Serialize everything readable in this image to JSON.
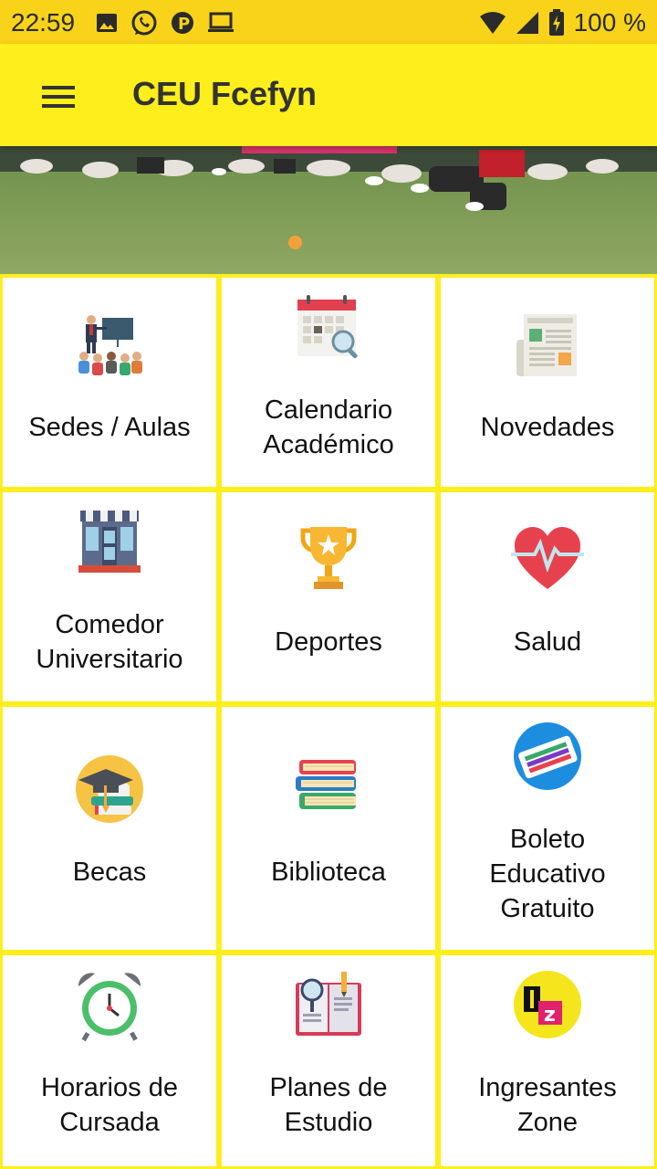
{
  "status_bar": {
    "time": "22:59",
    "battery": "100 %"
  },
  "app_bar": {
    "title": "CEU Fcefyn"
  },
  "carousel": {
    "pages": 1,
    "active": 0
  },
  "tiles": [
    {
      "label": "Sedes / Aulas",
      "icon": "classroom-icon"
    },
    {
      "label": "Calendario Académico",
      "icon": "calendar-icon"
    },
    {
      "label": "Novedades",
      "icon": "newspaper-icon"
    },
    {
      "label": "Comedor Universitario",
      "icon": "storefront-icon"
    },
    {
      "label": "Deportes",
      "icon": "trophy-icon"
    },
    {
      "label": "Salud",
      "icon": "heart-icon"
    },
    {
      "label": "Becas",
      "icon": "graduation-cap-icon"
    },
    {
      "label": "Biblioteca",
      "icon": "books-icon"
    },
    {
      "label": "Boleto Educativo Gratuito",
      "icon": "ticket-card-icon"
    },
    {
      "label": "Horarios de Cursada",
      "icon": "alarm-clock-icon"
    },
    {
      "label": "Planes de Estudio",
      "icon": "study-plan-icon"
    },
    {
      "label": "Ingresantes Zone",
      "icon": "iz-logo-icon"
    }
  ]
}
